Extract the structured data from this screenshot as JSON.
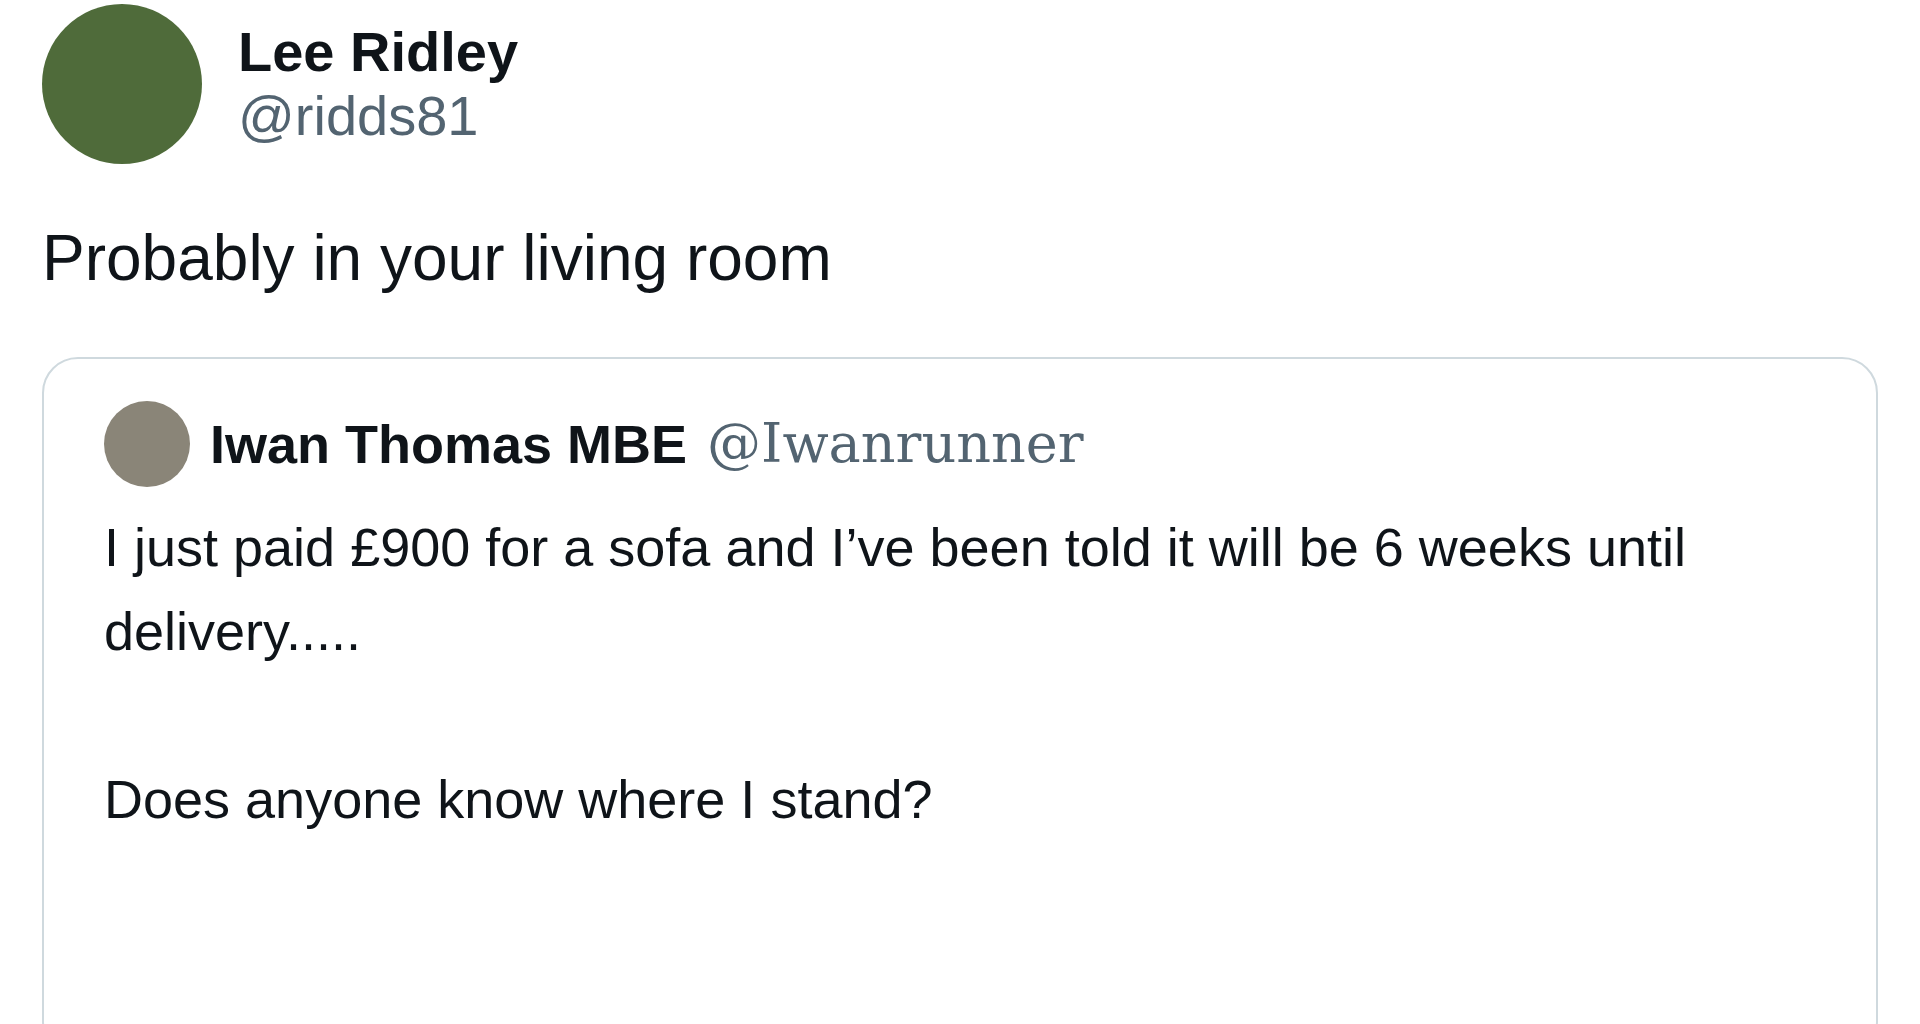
{
  "author": {
    "name": "Lee Ridley",
    "handle": "@ridds81"
  },
  "text": "Probably in your living room",
  "quoted_tweet": {
    "author": {
      "name": "Iwan Thomas MBE",
      "handle": "@Iwanrunner"
    },
    "paragraphs": [
      "I just paid £900 for a sofa and I’ve been told it will be 6 weeks until delivery.....",
      "Does anyone know where I stand?"
    ]
  }
}
